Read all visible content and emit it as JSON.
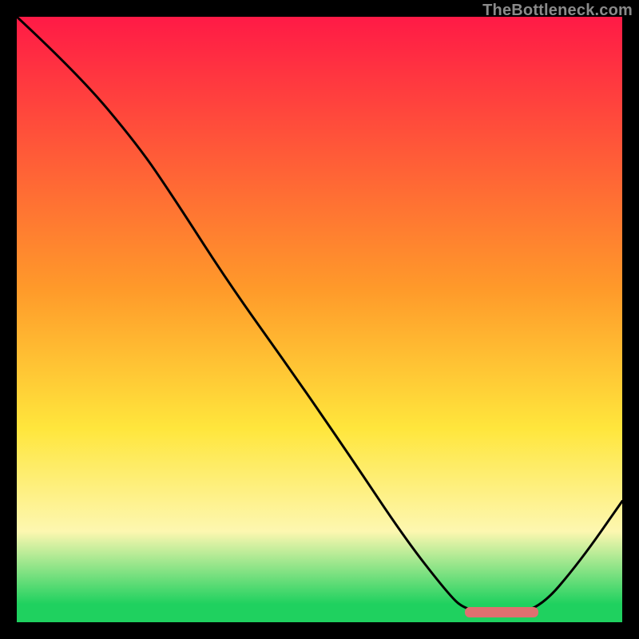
{
  "watermark": "TheBottleneck.com",
  "colors": {
    "red": "#ff1a46",
    "orange": "#ff9a2a",
    "yellow": "#ffe63c",
    "pale": "#fdf7b0",
    "green": "#1fd15f",
    "frame_bg": "#000000",
    "curve": "#000000",
    "marker": "#e07070"
  },
  "gradient_stops_percent": [
    {
      "pct": 0,
      "color_key": "red"
    },
    {
      "pct": 45,
      "color_key": "orange"
    },
    {
      "pct": 68,
      "color_key": "yellow"
    },
    {
      "pct": 85,
      "color_key": "pale"
    },
    {
      "pct": 97,
      "color_key": "green"
    },
    {
      "pct": 100,
      "color_key": "green"
    }
  ],
  "marker_rect_norm": {
    "x0": 0.74,
    "y0": 0.975,
    "x1": 0.862,
    "y1": 0.992
  },
  "chart_data": {
    "type": "line",
    "title": "",
    "xlabel": "",
    "ylabel": "",
    "xlim_norm": [
      0,
      1
    ],
    "ylim_norm": [
      0,
      1
    ],
    "series": [
      {
        "name": "bottleneck-curve",
        "points_norm": [
          {
            "x": 0.0,
            "y": 1.0
          },
          {
            "x": 0.1,
            "y": 0.907
          },
          {
            "x": 0.2,
            "y": 0.788
          },
          {
            "x": 0.26,
            "y": 0.7
          },
          {
            "x": 0.35,
            "y": 0.56
          },
          {
            "x": 0.45,
            "y": 0.42
          },
          {
            "x": 0.55,
            "y": 0.275
          },
          {
            "x": 0.64,
            "y": 0.14
          },
          {
            "x": 0.71,
            "y": 0.05
          },
          {
            "x": 0.74,
            "y": 0.02
          },
          {
            "x": 0.8,
            "y": 0.014
          },
          {
            "x": 0.862,
            "y": 0.02
          },
          {
            "x": 0.93,
            "y": 0.1
          },
          {
            "x": 1.0,
            "y": 0.2
          }
        ]
      }
    ],
    "optimum_band_norm": {
      "x0": 0.74,
      "x1": 0.862
    }
  }
}
